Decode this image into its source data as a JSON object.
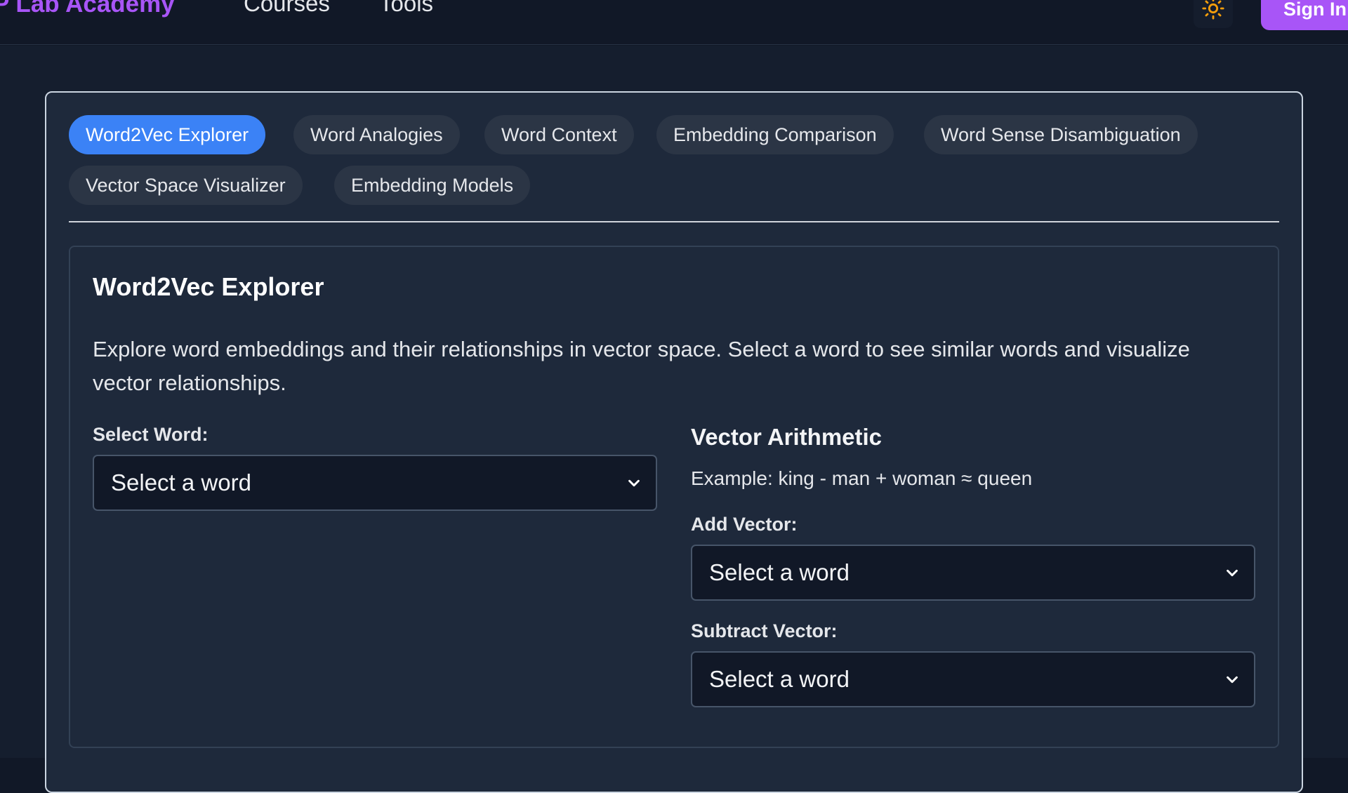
{
  "header": {
    "brand": "P Lab Academy",
    "nav": [
      "Courses",
      "Tools"
    ],
    "theme_toggle_icon": "sun-icon",
    "sign_in_label": "Sign In",
    "accent_color": "#a855f7"
  },
  "tabs": [
    {
      "label": "Word2Vec Explorer",
      "active": true
    },
    {
      "label": "Word Analogies",
      "active": false
    },
    {
      "label": "Word Context",
      "active": false
    },
    {
      "label": "Embedding Comparison",
      "active": false
    },
    {
      "label": "Word Sense Disambiguation",
      "active": false
    },
    {
      "label": "Vector Space Visualizer",
      "active": false
    },
    {
      "label": "Embedding Models",
      "active": false
    }
  ],
  "explorer": {
    "title": "Word2Vec Explorer",
    "description": "Explore word embeddings and their relationships in vector space. Select a word to see similar words and visualize vector relationships.",
    "select_word_label": "Select Word:",
    "select_word_value": "Select a word",
    "arithmetic": {
      "title": "Vector Arithmetic",
      "example": "Example: king - man + woman ≈ queen",
      "add_label": "Add Vector:",
      "add_value": "Select a word",
      "subtract_label": "Subtract Vector:",
      "subtract_value": "Select a word"
    }
  },
  "colors": {
    "active_tab": "#3b82f6",
    "background": "#111827",
    "card": "#1e293b"
  }
}
